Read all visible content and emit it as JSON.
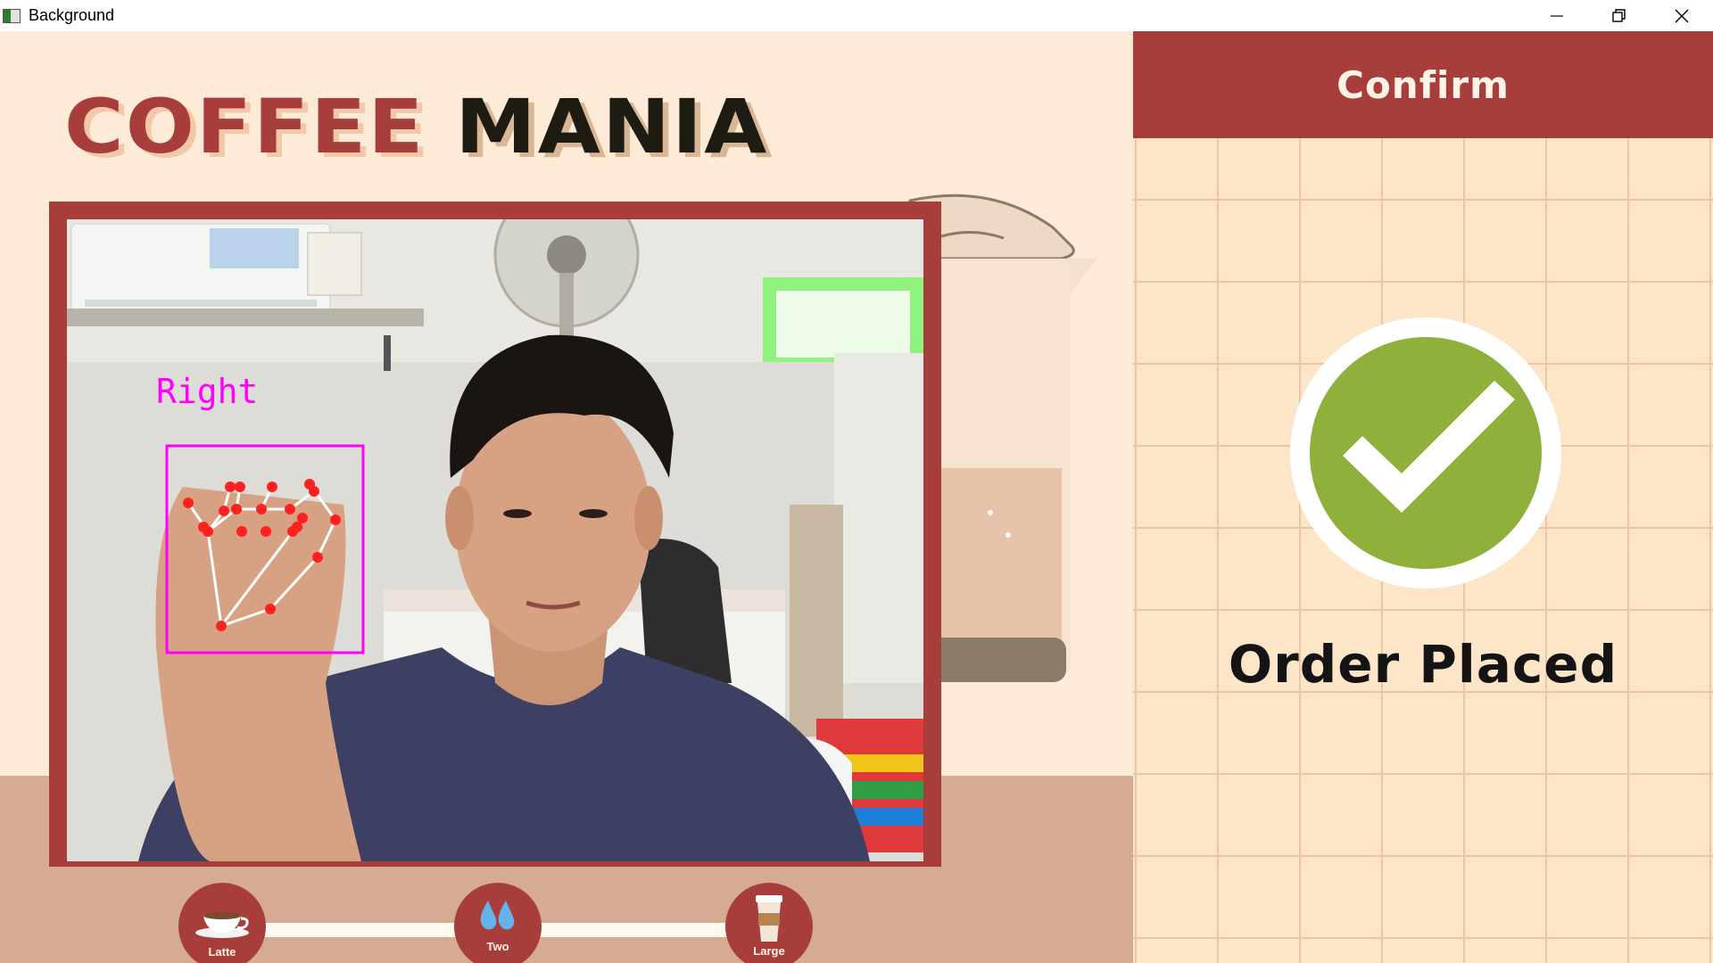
{
  "window": {
    "title": "Background",
    "controls": [
      "minimize",
      "restore",
      "close"
    ]
  },
  "app": {
    "logo_word1": "COFFEE",
    "logo_word2": "MANIA"
  },
  "camera": {
    "hand_label": "Right",
    "hand_landmarks": 21
  },
  "confirm_panel": {
    "header": "Confirm",
    "status_icon": "check-circle-icon",
    "status": "Order Placed"
  },
  "order_steps": [
    {
      "label": "Latte",
      "icon": "coffee-cup-icon"
    },
    {
      "label": "Two",
      "icon": "water-drops-icon"
    },
    {
      "label": "Large",
      "icon": "takeaway-cup-icon"
    }
  ],
  "colors": {
    "brand_red": "#a83e3c",
    "cream": "#fdebd8",
    "check_green": "#8fb03a",
    "hand_box": "#ff00ff",
    "landmark": "#ff0000"
  }
}
